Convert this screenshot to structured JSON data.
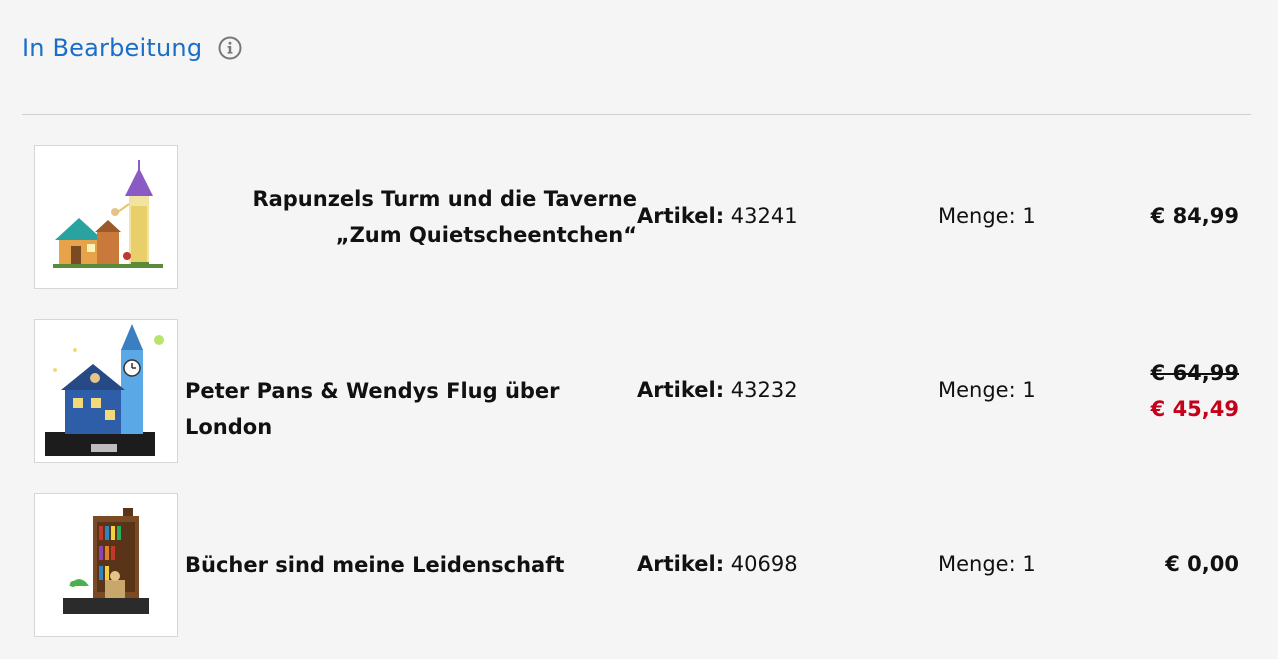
{
  "section": {
    "title": "In Bearbeitung",
    "info_icon": "info-icon"
  },
  "items": [
    {
      "name": "Rapunzels Turm und die Taverne „Zum Quietscheentchen“",
      "article_label": "Artikel:",
      "article_number": "43241",
      "quantity": "Menge: 1",
      "price": "€ 84,99"
    },
    {
      "name": "Peter Pans & Wendys Flug über London",
      "article_label": "Artikel:",
      "article_number": "43232",
      "quantity": "Menge: 1",
      "price_old": "€ 64,99",
      "price": "€ 45,49"
    },
    {
      "name": "Bücher sind meine Leidenschaft",
      "article_label": "Artikel:",
      "article_number": "40698",
      "quantity": "Menge: 1",
      "price": "€ 0,00"
    }
  ],
  "colors": {
    "accent": "#1a6ec7",
    "sale": "#c5001a",
    "text": "#111111"
  }
}
